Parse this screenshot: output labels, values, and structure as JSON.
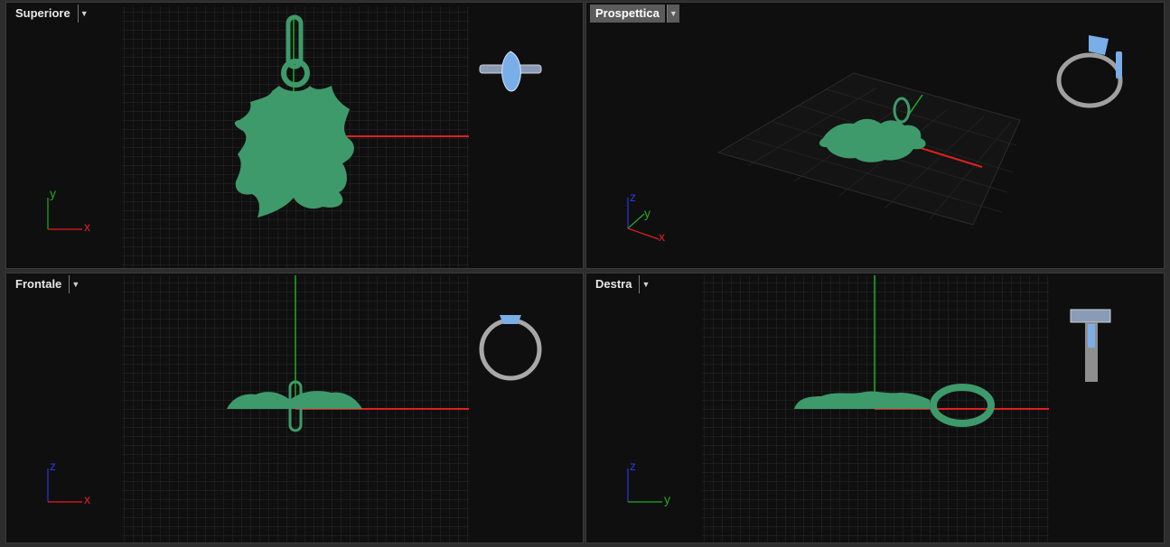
{
  "viewports": {
    "top": {
      "label": "Superiore",
      "axis_x": "x",
      "axis_y": "y"
    },
    "perspective": {
      "label": "Prospettica",
      "axis_x": "x",
      "axis_y": "y",
      "axis_z": "z"
    },
    "front": {
      "label": "Frontale",
      "axis_x": "x",
      "axis_z": "z"
    },
    "right": {
      "label": "Destra",
      "axis_y": "y",
      "axis_z": "z"
    }
  },
  "icons": {
    "dropdown": "chevron-down-icon",
    "navigation_cube": "ring-preview-icon"
  },
  "colors": {
    "viewport_bg": "#0f0f0f",
    "grid_line": "#2a2a2a",
    "model_green": "#3e9a6a",
    "axis_x": "#e02020",
    "axis_y": "#22aa22",
    "axis_z": "#2a3ad8",
    "ring_gem": "#7aaee8",
    "ring_metal": "#a0a0a0",
    "active_tab": "#5b5b5b"
  }
}
